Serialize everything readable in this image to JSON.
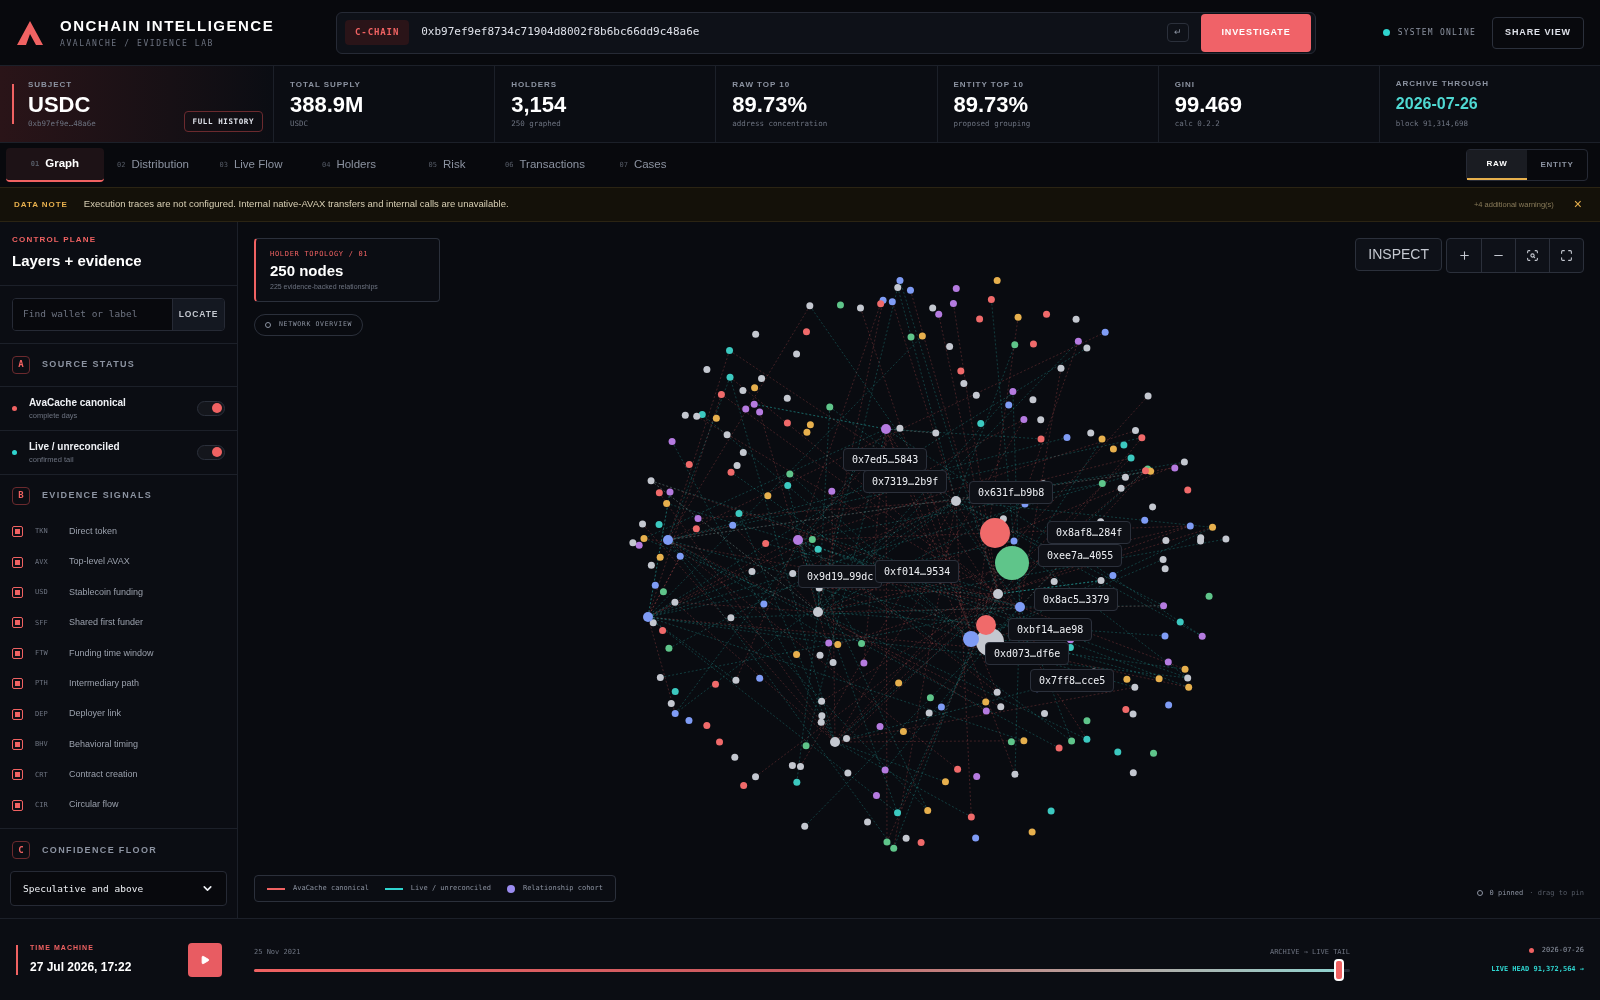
{
  "brand": {
    "title": "ONCHAIN INTELLIGENCE",
    "subtitle": "AVALANCHE / EVIDENCE LAB"
  },
  "search": {
    "chain": "C-CHAIN",
    "value": "0xb97ef9ef8734c71904d8002f8b6bc66dd9c48a6e",
    "enter_key": "↵",
    "button": "INVESTIGATE"
  },
  "system_status": {
    "label": "SYSTEM ONLINE",
    "online": true
  },
  "share_button": "SHARE VIEW",
  "stats": [
    {
      "kind": "subject",
      "label": "SUBJECT",
      "value": "USDC",
      "sub": "0xb97ef9e…48a6e",
      "button": "FULL HISTORY"
    },
    {
      "kind": "metric",
      "label": "TOTAL SUPPLY",
      "value": "388.9M",
      "sub": "USDC"
    },
    {
      "kind": "metric",
      "label": "HOLDERS",
      "value": "3,154",
      "sub": "250 graphed"
    },
    {
      "kind": "metric",
      "label": "RAW TOP 10",
      "value": "89.73%",
      "sub": "address concentration"
    },
    {
      "kind": "metric",
      "label": "ENTITY TOP 10",
      "value": "89.73%",
      "sub": "proposed grouping"
    },
    {
      "kind": "metric",
      "label": "GINI",
      "value": "99.469",
      "sub": "calc 0.2.2"
    },
    {
      "kind": "date",
      "label": "ARCHIVE THROUGH",
      "value": "2026-07-26",
      "sub": "block 91,314,698"
    }
  ],
  "tabs": [
    {
      "number": "01",
      "label": "Graph",
      "selected": true
    },
    {
      "number": "02",
      "label": "Distribution",
      "selected": false
    },
    {
      "number": "03",
      "label": "Live Flow",
      "selected": false
    },
    {
      "number": "04",
      "label": "Holders",
      "selected": false
    },
    {
      "number": "05",
      "label": "Risk",
      "selected": false
    },
    {
      "number": "06",
      "label": "Transactions",
      "selected": false
    },
    {
      "number": "07",
      "label": "Cases",
      "selected": false
    }
  ],
  "view_toggle": [
    {
      "label": "RAW",
      "selected": true
    },
    {
      "label": "ENTITY",
      "selected": false
    }
  ],
  "data_note": {
    "tag": "DATA NOTE",
    "text": "Execution traces are not configured. Internal native-AVAX transfers and internal calls are unavailable.",
    "extra": "+4 additional warning(s)",
    "close": "×"
  },
  "control_plane": {
    "eyebrow": "CONTROL PLANE",
    "title": "Layers + evidence",
    "search_placeholder": "Find wallet or label",
    "locate_button": "LOCATE",
    "source_section": {
      "letter": "A",
      "title": "SOURCE STATUS"
    },
    "sources": [
      {
        "name": "AvaCache canonical",
        "sub": "complete days",
        "color": "#f06262",
        "on": true
      },
      {
        "name": "Live / unreconciled",
        "sub": "confirmed tail",
        "color": "#2fd4cf",
        "on": true
      }
    ],
    "signals_section": {
      "letter": "B",
      "title": "EVIDENCE SIGNALS"
    },
    "signals": [
      {
        "code": "TKN",
        "label": "Direct token",
        "checked": true
      },
      {
        "code": "AVX",
        "label": "Top-level AVAX",
        "checked": true
      },
      {
        "code": "USD",
        "label": "Stablecoin funding",
        "checked": true
      },
      {
        "code": "SFF",
        "label": "Shared first funder",
        "checked": true
      },
      {
        "code": "FTW",
        "label": "Funding time window",
        "checked": true
      },
      {
        "code": "PTH",
        "label": "Intermediary path",
        "checked": true
      },
      {
        "code": "DEP",
        "label": "Deployer link",
        "checked": true
      },
      {
        "code": "BHV",
        "label": "Behavioral timing",
        "checked": true
      },
      {
        "code": "CRT",
        "label": "Contract creation",
        "checked": true
      },
      {
        "code": "CIR",
        "label": "Circular flow",
        "checked": true
      }
    ],
    "confidence_section": {
      "letter": "C",
      "title": "CONFIDENCE FLOOR"
    },
    "confidence_value": "Speculative and above"
  },
  "graph": {
    "card_eyebrow": "HOLDER TOPOLOGY / 01",
    "card_title": "250 nodes",
    "card_sub": "225 evidence-backed relationships",
    "overview_chip": "NETWORK OVERVIEW",
    "inspect_button": "INSPECT",
    "node_labels": [
      "0x7ed5…5843",
      "0x7319…2b9f",
      "0x631f…b9b8",
      "0x8af8…284f",
      "0xee7a…4055",
      "0x9d19…99dc",
      "0xf014…9534",
      "0x8ac5…3379",
      "0xbf14…ae98",
      "0xd073…df6e",
      "0x7ff8…cce5"
    ],
    "legend": [
      {
        "kind": "line",
        "label": "AvaCache canonical",
        "color": "#f06262"
      },
      {
        "kind": "line",
        "label": "Live / unreconciled",
        "color": "#2fd4cf"
      },
      {
        "kind": "dot",
        "label": "Relationship cohort",
        "color": "#9b8cf0"
      }
    ],
    "pinned": "0 pinned",
    "pin_hint": "· drag to pin"
  },
  "time_machine": {
    "eyebrow": "TIME MACHINE",
    "datetime": "27 Jul 2026, 17:22",
    "start": "25 Nov 2021",
    "range_label": "ARCHIVE → LIVE TAIL",
    "end_date": "2026-07-26",
    "live_head": "LIVE HEAD 91,372,564 →",
    "level": 0.99
  }
}
